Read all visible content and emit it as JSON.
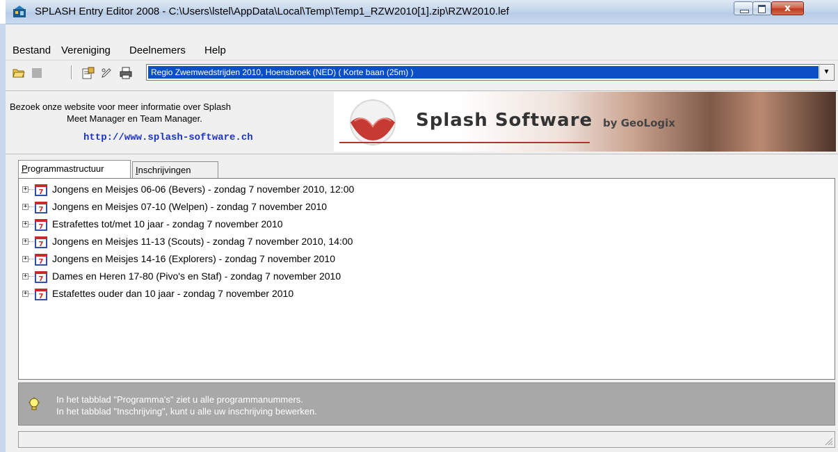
{
  "window": {
    "title": "SPLASH Entry Editor 2008 - C:\\Users\\lstel\\AppData\\Local\\Temp\\Temp1_RZW2010[1].zip\\RZW2010.lef",
    "close_symbol": "x"
  },
  "menu": {
    "items": [
      "Bestand",
      "Vereniging",
      "Deelnemers",
      "Help"
    ]
  },
  "toolbar": {
    "icons": [
      "open-folder-icon",
      "stop-icon",
      "properties-icon",
      "edit-icon",
      "print-icon"
    ],
    "meet_select": "Regio Zwemwedstrijden 2010,  Hoensbroek  (NED)   ( Korte baan (25m) )"
  },
  "banner": {
    "line1": "Bezoek onze website voor meer informatie over Splash",
    "line2": "Meet Manager en Team Manager.",
    "link": "http://www.splash-software.ch",
    "brand": "Splash Software",
    "brand_by": "by GeoLogix"
  },
  "tabs": [
    {
      "label_pre": "",
      "label_u": "P",
      "label_post": "rogrammastructuur"
    },
    {
      "label_pre": "",
      "label_u": "I",
      "label_post": "nschrijvingen"
    }
  ],
  "tree": {
    "items": [
      "Jongens en Meisjes 06-06 (Bevers) - zondag 7 november 2010, 12:00",
      "Jongens en Meisjes 07-10 (Welpen) - zondag 7 november 2010",
      "Estrafettes tot/met 10 jaar - zondag 7 november 2010",
      "Jongens en Meisjes 11-13 (Scouts) - zondag 7 november 2010, 14:00",
      "Jongens en Meisjes 14-16 (Explorers) - zondag 7 november 2010",
      "Dames en Heren 17-80 (Pivo's en Staf) - zondag 7 november 2010",
      "Estafettes ouder dan 10 jaar - zondag 7 november 2010"
    ],
    "expander_symbol": "+"
  },
  "hint": {
    "line1": "In het tabblad \"Programma's\" ziet u alle programmanummers.",
    "line2": "In het tabblad \"Inschrijving\", kunt u alle uw inschrijving bewerken."
  },
  "colors": {
    "selection": "#0a4fc5",
    "link": "#1933c7",
    "hint_panel": "#a8a8a8"
  }
}
